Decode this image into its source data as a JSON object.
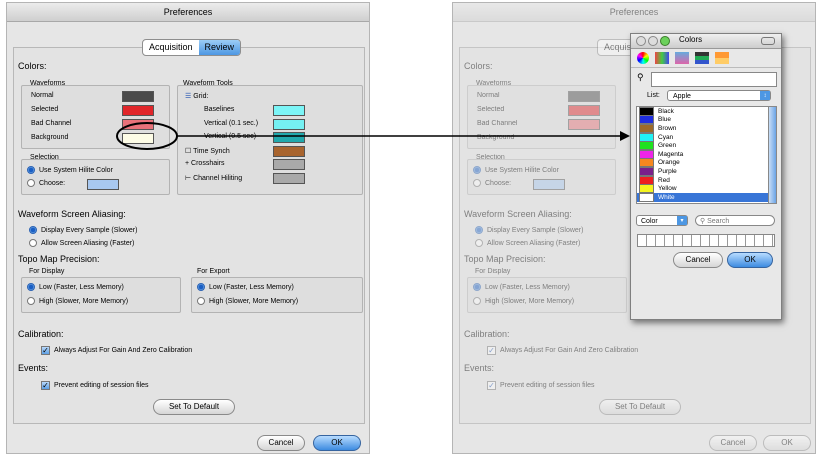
{
  "left_window": {
    "title": "Preferences",
    "tabs": [
      "Acquisition",
      "Review"
    ],
    "colors_heading": "Colors:",
    "waveforms_heading": "Waveforms",
    "waveform_items": [
      {
        "label": "Normal",
        "color": "#4a4a4a"
      },
      {
        "label": "Selected",
        "color": "#e0262a"
      },
      {
        "label": "Bad Channel",
        "color": "#e8727a"
      },
      {
        "label": "Background",
        "color": "#fdfce6"
      }
    ],
    "tools_heading": "Waveform Tools",
    "grid_label": "Grid:",
    "tool_items": [
      {
        "label": "Baselines",
        "color": "#7cf5f7"
      },
      {
        "label": "Vertical (0.1 sec.)",
        "color": "#75f0f2"
      },
      {
        "label": "Vertical (0.5 sec)",
        "color": "#21a9ad"
      },
      {
        "label": "Time Synch",
        "color": "#a8642e"
      },
      {
        "label": "Crosshairs",
        "color": "#a9a9a9"
      },
      {
        "label": "Channel Hiliting",
        "color": "#a9a9a9"
      }
    ],
    "selection_heading": "Selection",
    "selection_options": [
      "Use System Hilite Color",
      "Choose:"
    ],
    "choose_color": "#a8c8f0",
    "aliasing_heading": "Waveform Screen Aliasing:",
    "aliasing_options": [
      "Display Every Sample (Slower)",
      "Allow Screen Aliasing (Faster)"
    ],
    "topo_heading": "Topo Map Precision:",
    "for_display": "For Display",
    "for_export": "For Export",
    "display_options": [
      "Low (Faster, Less Memory)",
      "High (Slower, More Memory)"
    ],
    "export_options": [
      "Low (Faster, Less Memory)",
      "High (Slower, More Memory)"
    ],
    "calibration_heading": "Calibration:",
    "calibration_check": "Always Adjust For Gain And Zero Calibration",
    "events_heading": "Events:",
    "events_check": "Prevent editing of session files",
    "default_button": "Set To Default",
    "cancel_button": "Cancel",
    "ok_button": "OK"
  },
  "right_window": {
    "title": "Preferences",
    "tab_partial": "Acquisit",
    "colors_heading": "Colors:",
    "waveforms_heading": "Waveforms",
    "waveform_items": [
      "Normal",
      "Selected",
      "Bad Channel",
      "Background"
    ],
    "selection_heading": "Selection",
    "selection_options": [
      "Use System Hilite Color",
      "Choose:"
    ],
    "aliasing_heading": "Waveform Screen Aliasing:",
    "aliasing_options": [
      "Display Every Sample (Slower)",
      "Allow Screen Aliasing (Faster)"
    ],
    "topo_heading": "Topo Map Precision:",
    "for_display": "For Display",
    "display_options": [
      "Low (Faster, Less Memory)",
      "High (Slower, More Memory)"
    ],
    "calibration_heading": "Calibration:",
    "calibration_check": "Always Adjust For Gain And Zero Calibration",
    "events_heading": "Events:",
    "events_check": "Prevent editing of session files",
    "default_button": "Set To Default",
    "cancel_button": "Cancel",
    "ok_button": "OK"
  },
  "colors_window": {
    "title": "Colors",
    "list_label": "List:",
    "list_value": "Apple",
    "colors": [
      {
        "name": "Black",
        "color": "#000000"
      },
      {
        "name": "Blue",
        "color": "#1f2ee0"
      },
      {
        "name": "Brown",
        "color": "#9c6a2a"
      },
      {
        "name": "Cyan",
        "color": "#21f2f5"
      },
      {
        "name": "Green",
        "color": "#1fe21f"
      },
      {
        "name": "Magenta",
        "color": "#ee24e8"
      },
      {
        "name": "Orange",
        "color": "#f6871f"
      },
      {
        "name": "Purple",
        "color": "#7a1f8a"
      },
      {
        "name": "Red",
        "color": "#ee1f1f"
      },
      {
        "name": "Yellow",
        "color": "#f5f51f"
      },
      {
        "name": "White",
        "color": "#ffffff"
      }
    ],
    "selected_color": "White",
    "color_menu": "Color",
    "search_placeholder": "Search",
    "cancel_button": "Cancel",
    "ok_button": "OK"
  }
}
